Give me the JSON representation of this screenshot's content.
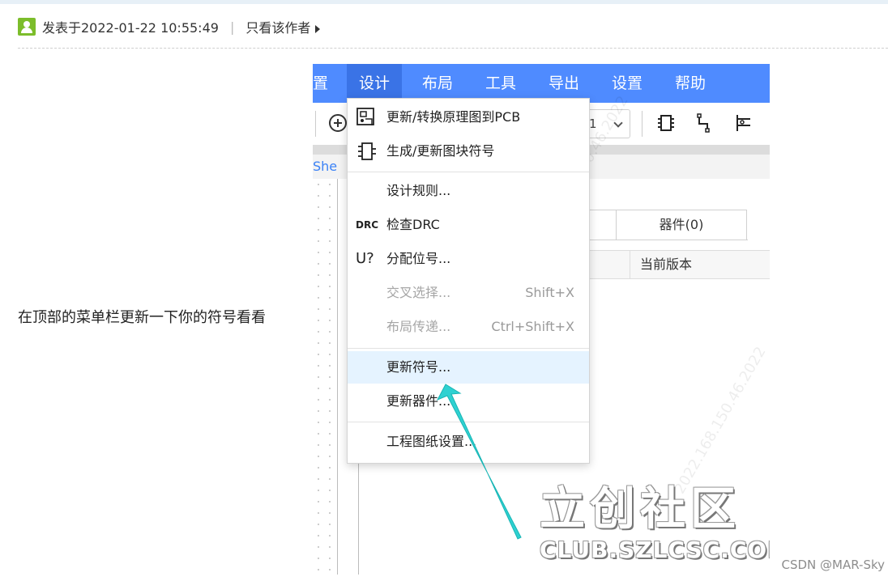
{
  "post": {
    "date_text": "发表于2022-01-22 10:55:49",
    "separator": "|",
    "author_only": "只看该作者",
    "reply_text": "在顶部的菜单栏更新一下你的符号看看"
  },
  "screenshot": {
    "menubar": [
      "置",
      "设计",
      "布局",
      "工具",
      "导出",
      "设置",
      "帮助"
    ],
    "toolbar": {
      "zoom_value": "1"
    },
    "sheet_tab": "She",
    "panel_tabs": [
      "器件(0)"
    ],
    "column_header": "当前版本",
    "dropdown": [
      {
        "label": "更新/转换原理图到PCB",
        "icon": "pcb-convert-icon"
      },
      {
        "label": "生成/更新图块符号",
        "icon": "block-symbol-icon"
      },
      {
        "label": "设计规则...",
        "icon": ""
      },
      {
        "label": "检查DRC",
        "icon": "DRC"
      },
      {
        "label": "分配位号...",
        "icon": "U?"
      },
      {
        "label": "交叉选择...",
        "shortcut": "Shift+X",
        "disabled": true
      },
      {
        "label": "布局传递...",
        "shortcut": "Ctrl+Shift+X",
        "disabled": true
      },
      {
        "label": "更新符号...",
        "highlighted": true
      },
      {
        "label": "更新器件...",
        "icon": ""
      },
      {
        "label": "工程图纸设置...",
        "icon": ""
      }
    ],
    "watermark_text": "2022.168.150.46.2022",
    "logo_big": "立创社区",
    "logo_small": "CLUB.SZLCSC.COM"
  },
  "csdn_watermark": "CSDN @MAR-Sky",
  "colors": {
    "menubar": "#4f8bff",
    "highlight": "#e5f3ff",
    "arrow": "#2ed1d1",
    "avatar": "#7cbd2b"
  }
}
